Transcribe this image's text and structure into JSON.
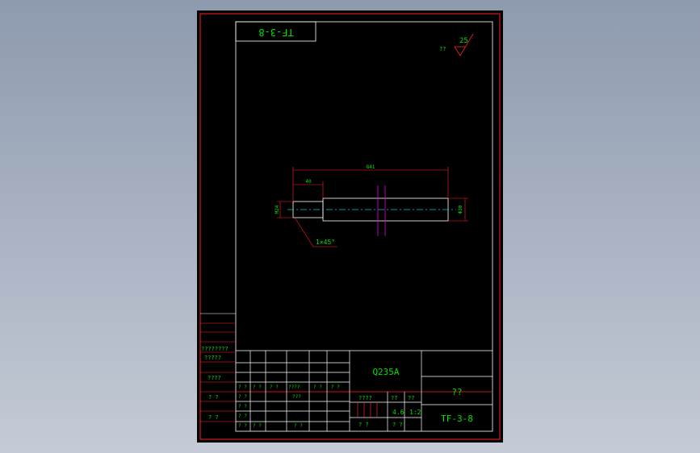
{
  "drawing": {
    "drawing_number_top": "TF-3-8",
    "roughness": {
      "value": "25",
      "label": "??"
    },
    "dimensions": {
      "overall_length": "841",
      "step_length": "40",
      "small_diameter": "M24",
      "large_diameter": "Φ30",
      "chamfer": "1×45°"
    }
  },
  "title_block": {
    "material": "Q235A",
    "part_name": "??",
    "drawing_number": "TF-3-8",
    "scale_label": "??",
    "sheet_label": "??",
    "scale_value": "1:2",
    "weight_value": "4.6",
    "label_weight": "????",
    "label_small": "? ?",
    "left_column": [
      "????????",
      "?????",
      "????",
      "?  ?",
      "?  ?"
    ],
    "rev_cells": [
      "? ?",
      "? ?",
      "? ?",
      "? ?",
      "????",
      "? ?",
      "? ?"
    ],
    "row2": [
      "? ?",
      "? ?",
      "? ?",
      "????",
      "? ?",
      "? ?"
    ],
    "row3": [
      "? ?",
      "???"
    ],
    "row4": [
      "? ?"
    ],
    "row5": [
      "? ?",
      "? ?",
      "? ?",
      "? ?"
    ]
  },
  "colors": {
    "frame": "#ff2020",
    "line": "#ffffff",
    "text": "#00e000",
    "center": "#00c8c8",
    "magenta": "#e000e0"
  }
}
